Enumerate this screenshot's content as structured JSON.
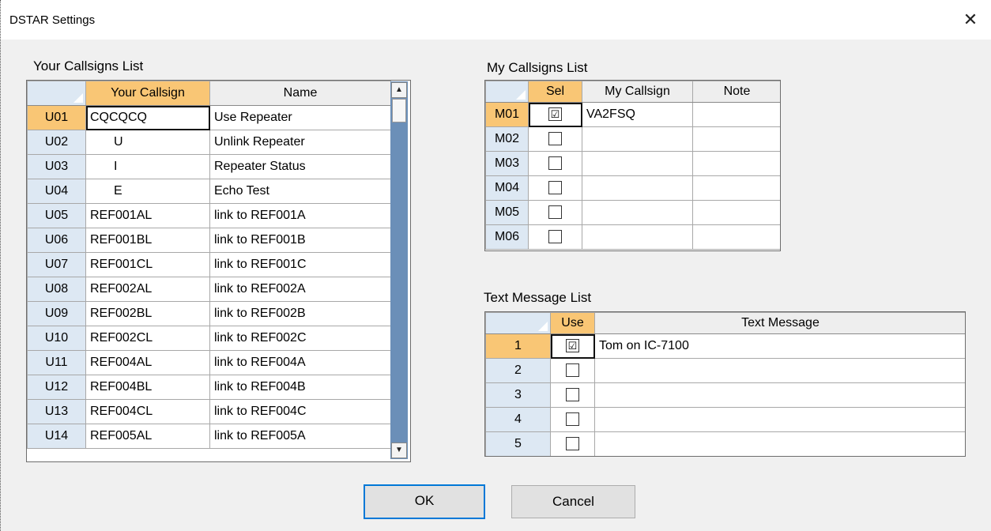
{
  "window": {
    "title": "DSTAR Settings",
    "close_glyph": "✕"
  },
  "your_callsigns": {
    "label": "Your Callsigns List",
    "headers": [
      "Your Callsign",
      "Name"
    ],
    "rows": [
      {
        "id": "U01",
        "callsign": "CQCQCQ",
        "name": "Use Repeater"
      },
      {
        "id": "U02",
        "callsign": "U",
        "name": "Unlink Repeater"
      },
      {
        "id": "U03",
        "callsign": "I",
        "name": "Repeater Status"
      },
      {
        "id": "U04",
        "callsign": "E",
        "name": "Echo Test"
      },
      {
        "id": "U05",
        "callsign": "REF001AL",
        "name": "link to REF001A"
      },
      {
        "id": "U06",
        "callsign": "REF001BL",
        "name": "link to REF001B"
      },
      {
        "id": "U07",
        "callsign": "REF001CL",
        "name": "link to REF001C"
      },
      {
        "id": "U08",
        "callsign": "REF002AL",
        "name": "link to REF002A"
      },
      {
        "id": "U09",
        "callsign": "REF002BL",
        "name": "link to REF002B"
      },
      {
        "id": "U10",
        "callsign": "REF002CL",
        "name": "link to REF002C"
      },
      {
        "id": "U11",
        "callsign": "REF004AL",
        "name": "link to REF004A"
      },
      {
        "id": "U12",
        "callsign": "REF004BL",
        "name": "link to REF004B"
      },
      {
        "id": "U13",
        "callsign": "REF004CL",
        "name": "link to REF004C"
      },
      {
        "id": "U14",
        "callsign": "REF005AL",
        "name": "link to REF005A"
      }
    ],
    "scroll_up_glyph": "▲",
    "scroll_down_glyph": "▼"
  },
  "my_callsigns": {
    "label": "My Callsigns List",
    "headers": [
      "Sel",
      "My Callsign",
      "Note"
    ],
    "rows": [
      {
        "id": "M01",
        "checked": "☑",
        "callsign": "VA2FSQ",
        "note": ""
      },
      {
        "id": "M02",
        "checked": "",
        "callsign": "",
        "note": ""
      },
      {
        "id": "M03",
        "checked": "",
        "callsign": "",
        "note": ""
      },
      {
        "id": "M04",
        "checked": "",
        "callsign": "",
        "note": ""
      },
      {
        "id": "M05",
        "checked": "",
        "callsign": "",
        "note": ""
      },
      {
        "id": "M06",
        "checked": "",
        "callsign": "",
        "note": ""
      }
    ]
  },
  "text_messages": {
    "label": "Text Message List",
    "headers": [
      "Use",
      "Text Message"
    ],
    "rows": [
      {
        "id": "1",
        "checked": "☑",
        "message": "Tom on IC-7100"
      },
      {
        "id": "2",
        "checked": "",
        "message": ""
      },
      {
        "id": "3",
        "checked": "",
        "message": ""
      },
      {
        "id": "4",
        "checked": "",
        "message": ""
      },
      {
        "id": "5",
        "checked": "",
        "message": ""
      }
    ]
  },
  "buttons": {
    "ok": "OK",
    "cancel": "Cancel"
  },
  "colors": {
    "header_highlight": "#f9c675",
    "row_header": "#dde8f3",
    "scrollbar": "#6b8fb8",
    "default_button_border": "#0078d7"
  }
}
